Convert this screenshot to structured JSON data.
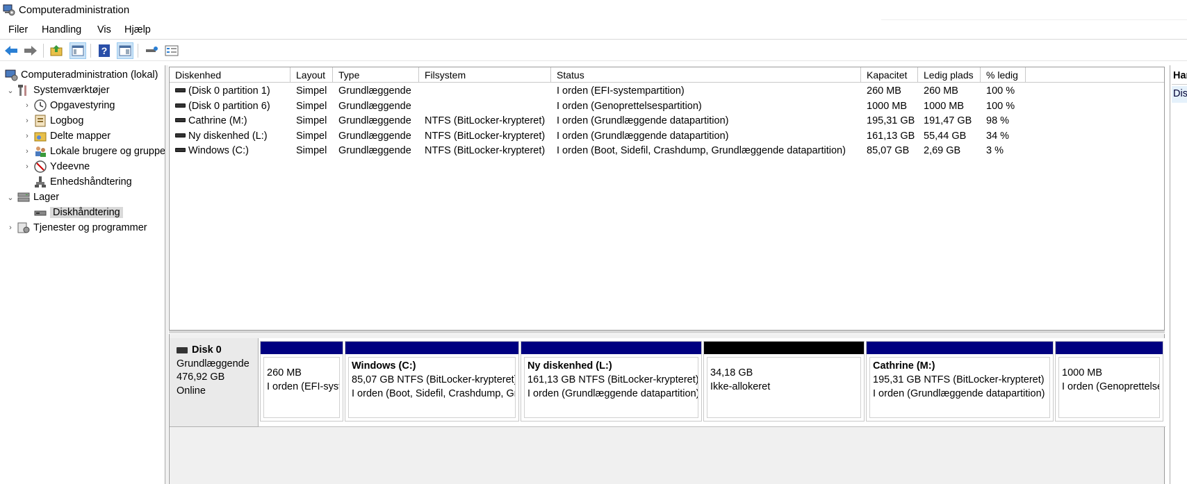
{
  "window": {
    "title": "Computeradministration"
  },
  "menu": [
    "Filer",
    "Handling",
    "Vis",
    "Hjælp"
  ],
  "toolbar": {
    "buttons": [
      "back-arrow-icon",
      "forward-arrow-icon",
      "up-folder-icon",
      "show-hide-tree-icon",
      "help-icon",
      "properties-icon",
      "key-icon",
      "detail-view-icon"
    ]
  },
  "tree": {
    "root": "Computeradministration (lokal)",
    "system_tools": "Systemværktøjer",
    "scheduler": "Opgavestyring",
    "eventlog": "Logbog",
    "shared": "Delte mapper",
    "local_users": "Lokale brugere og grupper",
    "performance": "Ydeevne",
    "device_manager": "Enhedshåndtering",
    "storage": "Lager",
    "disk_mgmt": "Diskhåndtering",
    "services": "Tjenester og programmer"
  },
  "columns": [
    "Diskenhed",
    "Layout",
    "Type",
    "Filsystem",
    "Status",
    "Kapacitet",
    "Ledig plads",
    "% ledig"
  ],
  "volumes": [
    {
      "name": "(Disk 0 partition 1)",
      "layout": "Simpel",
      "type": "Grundlæggende",
      "fs": "",
      "status": "I orden (EFI-systempartition)",
      "capacity": "260 MB",
      "free": "260 MB",
      "pct": "100 %"
    },
    {
      "name": "(Disk 0 partition 6)",
      "layout": "Simpel",
      "type": "Grundlæggende",
      "fs": "",
      "status": "I orden (Genoprettelsespartition)",
      "capacity": "1000 MB",
      "free": "1000 MB",
      "pct": "100 %"
    },
    {
      "name": "Cathrine (M:)",
      "layout": "Simpel",
      "type": "Grundlæggende",
      "fs": "NTFS (BitLocker-krypteret)",
      "status": "I orden (Grundlæggende datapartition)",
      "capacity": "195,31 GB",
      "free": "191,47 GB",
      "pct": "98 %"
    },
    {
      "name": "Ny diskenhed (L:)",
      "layout": "Simpel",
      "type": "Grundlæggende",
      "fs": "NTFS (BitLocker-krypteret)",
      "status": "I orden (Grundlæggende datapartition)",
      "capacity": "161,13 GB",
      "free": "55,44 GB",
      "pct": "34 %"
    },
    {
      "name": "Windows (C:)",
      "layout": "Simpel",
      "type": "Grundlæggende",
      "fs": "NTFS (BitLocker-krypteret)",
      "status": "I orden (Boot, Sidefil, Crashdump, Grundlæggende datapartition)",
      "capacity": "85,07 GB",
      "free": "2,69 GB",
      "pct": "3 %"
    }
  ],
  "disk": {
    "name": "Disk 0",
    "type": "Grundlæggende",
    "size": "476,92 GB",
    "state": "Online",
    "partitions": [
      {
        "title": "",
        "line1": "260 MB",
        "line2": "I orden (EFI-systempartition)",
        "unallocated": false
      },
      {
        "title": "Windows  (C:)",
        "line1": "85,07 GB NTFS (BitLocker-krypteret)",
        "line2": "I orden (Boot, Sidefil, Crashdump, Grundlæggende datapartition)",
        "unallocated": false
      },
      {
        "title": "Ny diskenhed  (L:)",
        "line1": "161,13 GB NTFS (BitLocker-krypteret)",
        "line2": "I orden (Grundlæggende datapartition)",
        "unallocated": false
      },
      {
        "title": "",
        "line1": "34,18 GB",
        "line2": "Ikke-allokeret",
        "unallocated": true
      },
      {
        "title": "Cathrine  (M:)",
        "line1": "195,31 GB NTFS (BitLocker-krypteret)",
        "line2": "I orden (Grundlæggende datapartition)",
        "unallocated": false
      },
      {
        "title": "",
        "line1": "1000 MB",
        "line2": "I orden (Genoprettelsespartition)",
        "unallocated": false
      }
    ]
  },
  "actions": {
    "header": "Handlinger",
    "item": "Diskhåndtering"
  },
  "colors": {
    "primary_partition": "#000080",
    "unallocated": "#000000",
    "selection": "#d9d9d9"
  }
}
